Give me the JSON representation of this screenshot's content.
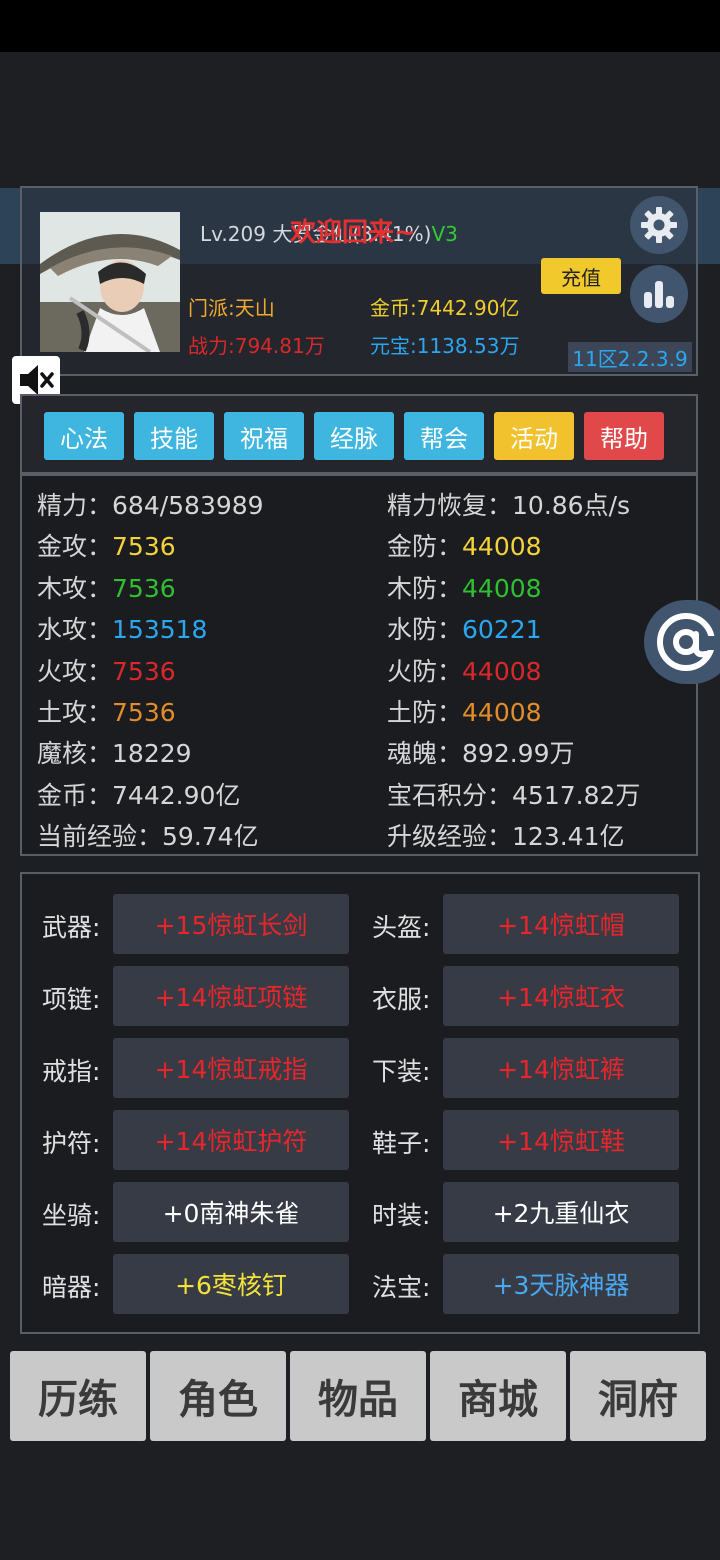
{
  "header": {
    "level_text": "Lv.209 大罗金仙(3.41%)",
    "vip": "V3",
    "welcome": "欢迎回来~",
    "recharge_label": "充值",
    "sect": "门派:天山",
    "power": "战力:794.81万",
    "gold": "金币:7442.90亿",
    "ingot": "元宝:1138.53万",
    "server": "11区2.2.3.9"
  },
  "menu": [
    {
      "label": "心法",
      "color": "#3fb6df"
    },
    {
      "label": "技能",
      "color": "#3fb6df"
    },
    {
      "label": "祝福",
      "color": "#3fb6df"
    },
    {
      "label": "经脉",
      "color": "#3fb6df"
    },
    {
      "label": "帮会",
      "color": "#3fb6df"
    },
    {
      "label": "活动",
      "color": "#f2c12e"
    },
    {
      "label": "帮助",
      "color": "#e0484a"
    }
  ],
  "stats": [
    {
      "k1": "精力：",
      "v1": "684/583989",
      "c1": "#d6d6d6",
      "k2": "精力恢复：",
      "v2": "10.86点/s",
      "c2": "#d6d6d6"
    },
    {
      "k1": "金攻：",
      "v1": "7536",
      "c1": "#f4d23a",
      "k2": "金防：",
      "v2": "44008",
      "c2": "#f4d23a"
    },
    {
      "k1": "木攻：",
      "v1": "7536",
      "c1": "#2fbf2f",
      "k2": "木防：",
      "v2": "44008",
      "c2": "#2fbf2f"
    },
    {
      "k1": "水攻：",
      "v1": "153518",
      "c1": "#2ba7f2",
      "k2": "水防：",
      "v2": "60221",
      "c2": "#2ba7f2"
    },
    {
      "k1": "火攻：",
      "v1": "7536",
      "c1": "#d8282a",
      "k2": "火防：",
      "v2": "44008",
      "c2": "#d8282a"
    },
    {
      "k1": "土攻：",
      "v1": "7536",
      "c1": "#e38c2a",
      "k2": "土防：",
      "v2": "44008",
      "c2": "#e38c2a"
    },
    {
      "k1": "魔核：",
      "v1": "18229",
      "c1": "#d6d6d6",
      "k2": "魂魄：",
      "v2": "892.99万",
      "c2": "#d6d6d6"
    },
    {
      "k1": "金币：",
      "v1": "7442.90亿",
      "c1": "#d6d6d6",
      "k2": "宝石积分：",
      "v2": "4517.82万",
      "c2": "#d6d6d6"
    },
    {
      "k1": "当前经验：",
      "v1": "59.74亿",
      "c1": "#d6d6d6",
      "k2": "升级经验：",
      "v2": "123.41亿",
      "c2": "#d6d6d6"
    }
  ],
  "equipment": [
    {
      "l1": "武器:",
      "i1": "+15惊虹长剑",
      "c1": "#e8262a",
      "l2": "头盔:",
      "i2": "+14惊虹帽",
      "c2": "#e8262a"
    },
    {
      "l1": "项链:",
      "i1": "+14惊虹项链",
      "c1": "#e8262a",
      "l2": "衣服:",
      "i2": "+14惊虹衣",
      "c2": "#e8262a"
    },
    {
      "l1": "戒指:",
      "i1": "+14惊虹戒指",
      "c1": "#e8262a",
      "l2": "下装:",
      "i2": "+14惊虹裤",
      "c2": "#e8262a"
    },
    {
      "l1": "护符:",
      "i1": "+14惊虹护符",
      "c1": "#e8262a",
      "l2": "鞋子:",
      "i2": "+14惊虹鞋",
      "c2": "#e8262a"
    },
    {
      "l1": "坐骑:",
      "i1": "+0南神朱雀",
      "c1": "#ffffff",
      "l2": "时装:",
      "i2": "+2九重仙衣",
      "c2": "#ffffff"
    },
    {
      "l1": "暗器:",
      "i1": "+6枣核钉",
      "c1": "#f4e23a",
      "l2": "法宝:",
      "i2": "+3天脉神器",
      "c2": "#4aa8f0"
    }
  ],
  "nav": [
    "历练",
    "角色",
    "物品",
    "商城",
    "洞府"
  ]
}
